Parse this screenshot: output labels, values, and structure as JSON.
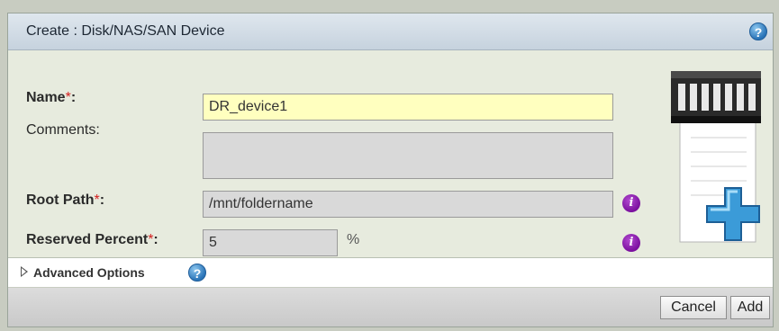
{
  "dialog": {
    "title": "Create : Disk/NAS/SAN Device",
    "help_glyph": "?"
  },
  "form": {
    "name": {
      "label": "Name",
      "required_mark": "*",
      "colon": ":",
      "value": "DR_device1"
    },
    "comments": {
      "label": "Comments:",
      "value": ""
    },
    "root_path": {
      "label": "Root Path",
      "required_mark": "*",
      "colon": ":",
      "value": "/mnt/foldername"
    },
    "reserved_percent": {
      "label": "Reserved Percent",
      "required_mark": "*",
      "colon": ":",
      "value": "5",
      "unit": "%"
    },
    "info_glyph": "i"
  },
  "advanced": {
    "label": "Advanced Options",
    "icon": "triangle-right-icon"
  },
  "footer": {
    "cancel_label": "Cancel",
    "add_label": "Add"
  },
  "colors": {
    "required": "#d42020",
    "info": "#7a0f9e",
    "help": "#2a74b8",
    "name_field_bg": "#ffffbf"
  }
}
